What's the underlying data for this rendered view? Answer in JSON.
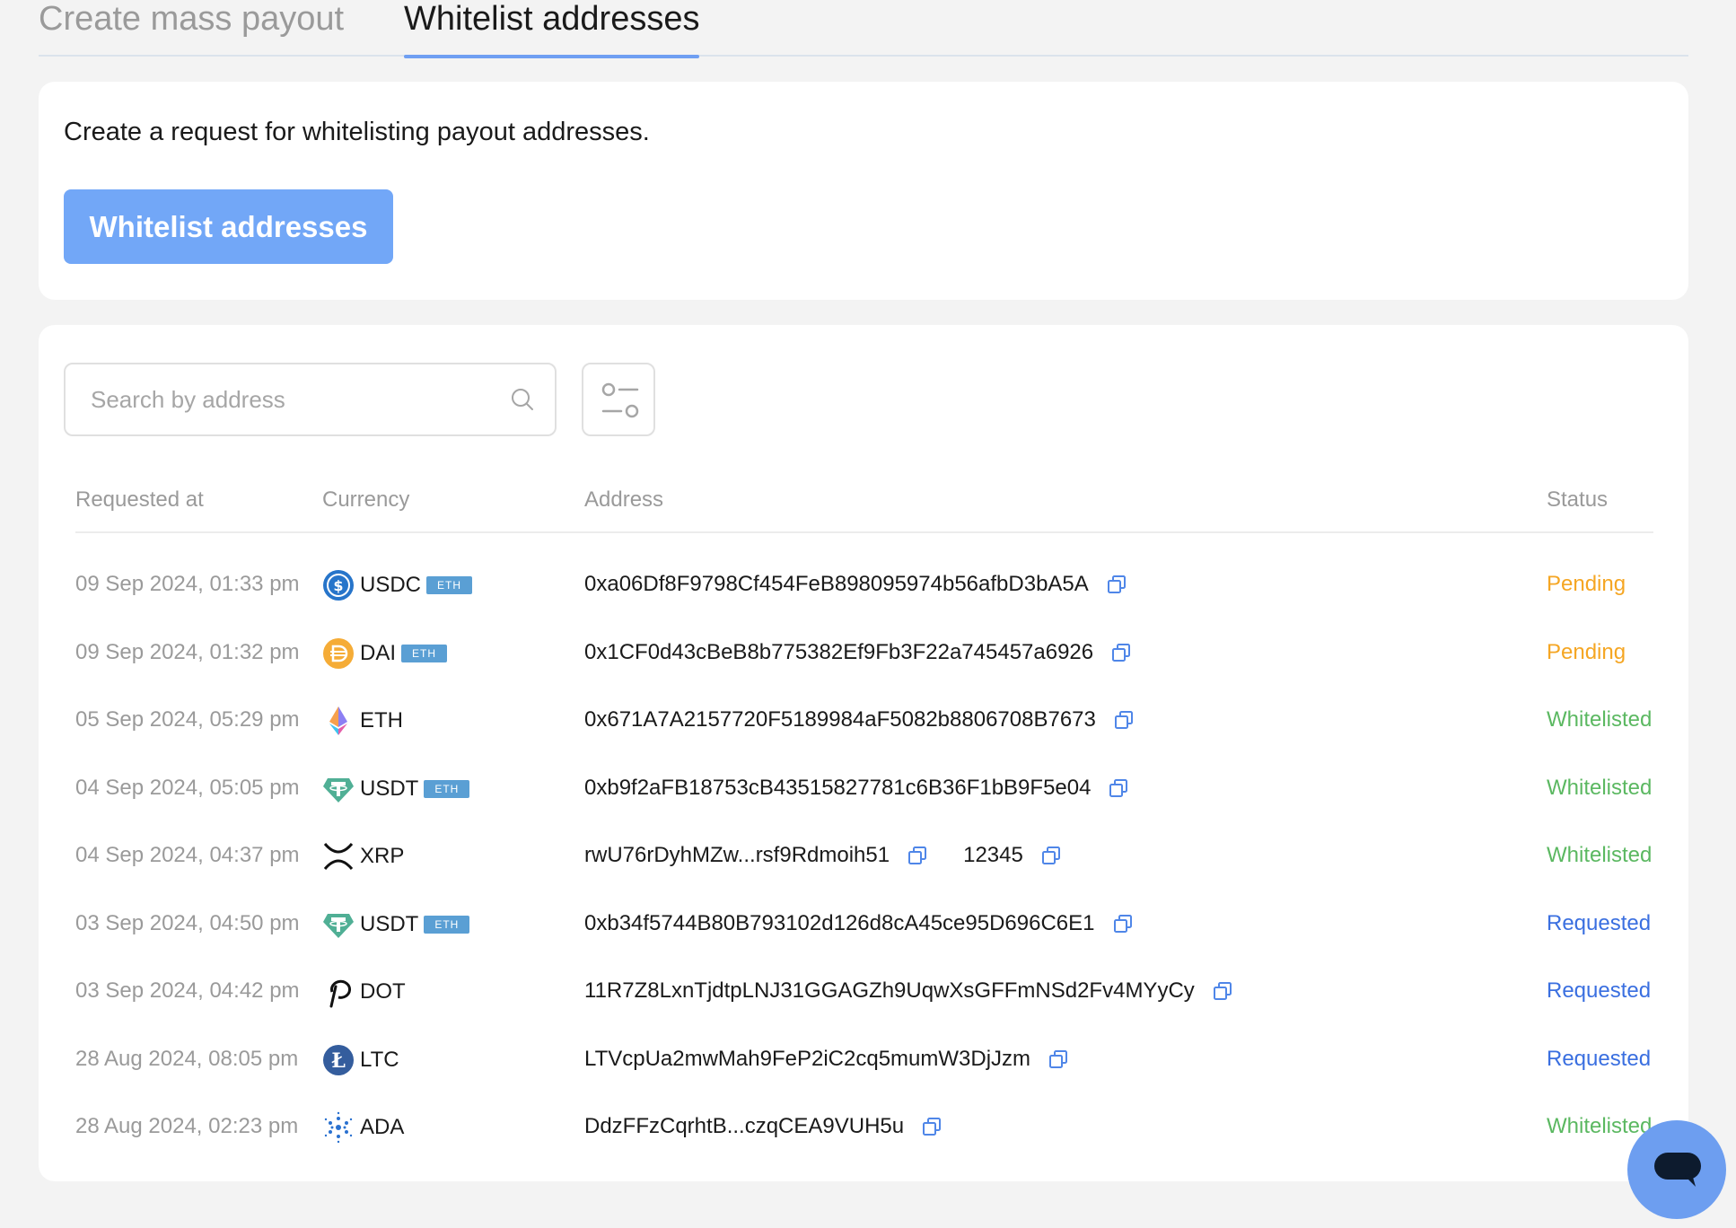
{
  "tabs": [
    {
      "label": "Create mass payout",
      "active": false
    },
    {
      "label": "Whitelist addresses",
      "active": true
    }
  ],
  "intro": {
    "text": "Create a request for whitelisting payout addresses.",
    "button_label": "Whitelist addresses"
  },
  "search": {
    "placeholder": "Search by address",
    "value": ""
  },
  "table": {
    "headers": {
      "requested_at": "Requested at",
      "currency": "Currency",
      "address": "Address",
      "status": "Status"
    },
    "rows": [
      {
        "date": "09 Sep 2024, 01:33 pm",
        "currency": "USDC",
        "network": "ETH",
        "coin": "usdc",
        "address": "0xa06Df8F9798Cf454FeB898095974b56afbD3bA5A",
        "memo": "",
        "status": "Pending",
        "status_key": "pending"
      },
      {
        "date": "09 Sep 2024, 01:32 pm",
        "currency": "DAI",
        "network": "ETH",
        "coin": "dai",
        "address": "0x1CF0d43cBeB8b775382Ef9Fb3F22a745457a6926",
        "memo": "",
        "status": "Pending",
        "status_key": "pending"
      },
      {
        "date": "05 Sep 2024, 05:29 pm",
        "currency": "ETH",
        "network": "",
        "coin": "eth",
        "address": "0x671A7A2157720F5189984aF5082b8806708B7673",
        "memo": "",
        "status": "Whitelisted",
        "status_key": "whitelisted"
      },
      {
        "date": "04 Sep 2024, 05:05 pm",
        "currency": "USDT",
        "network": "ETH",
        "coin": "usdt",
        "address": "0xb9f2aFB18753cB43515827781c6B36F1bB9F5e04",
        "memo": "",
        "status": "Whitelisted",
        "status_key": "whitelisted"
      },
      {
        "date": "04 Sep 2024, 04:37 pm",
        "currency": "XRP",
        "network": "",
        "coin": "xrp",
        "address": "rwU76rDyhMZw...rsf9Rdmoih51",
        "memo": "12345",
        "status": "Whitelisted",
        "status_key": "whitelisted"
      },
      {
        "date": "03 Sep 2024, 04:50 pm",
        "currency": "USDT",
        "network": "ETH",
        "coin": "usdt",
        "address": "0xb34f5744B80B793102d126d8cA45ce95D696C6E1",
        "memo": "",
        "status": "Requested",
        "status_key": "requested"
      },
      {
        "date": "03 Sep 2024, 04:42 pm",
        "currency": "DOT",
        "network": "",
        "coin": "dot",
        "address": "11R7Z8LxnTjdtpLNJ31GGAGZh9UqwXsGFFmNSd2Fv4MYyCy",
        "memo": "",
        "status": "Requested",
        "status_key": "requested"
      },
      {
        "date": "28 Aug 2024, 08:05 pm",
        "currency": "LTC",
        "network": "",
        "coin": "ltc",
        "address": "LTVcpUa2mwMah9FeP2iC2cq5mumW3DjJzm",
        "memo": "",
        "status": "Requested",
        "status_key": "requested"
      },
      {
        "date": "28 Aug 2024, 02:23 pm",
        "currency": "ADA",
        "network": "",
        "coin": "ada",
        "address": "DdzFFzCqrhtB...czqCEA9VUH5u",
        "memo": "",
        "status": "Whitelisted",
        "status_key": "whitelisted"
      }
    ]
  },
  "colors": {
    "accent": "#72a7f7",
    "pending": "#f5a623",
    "whitelisted": "#5bb861",
    "requested": "#3a6fe0",
    "network_badge": "#5a9fd4"
  }
}
